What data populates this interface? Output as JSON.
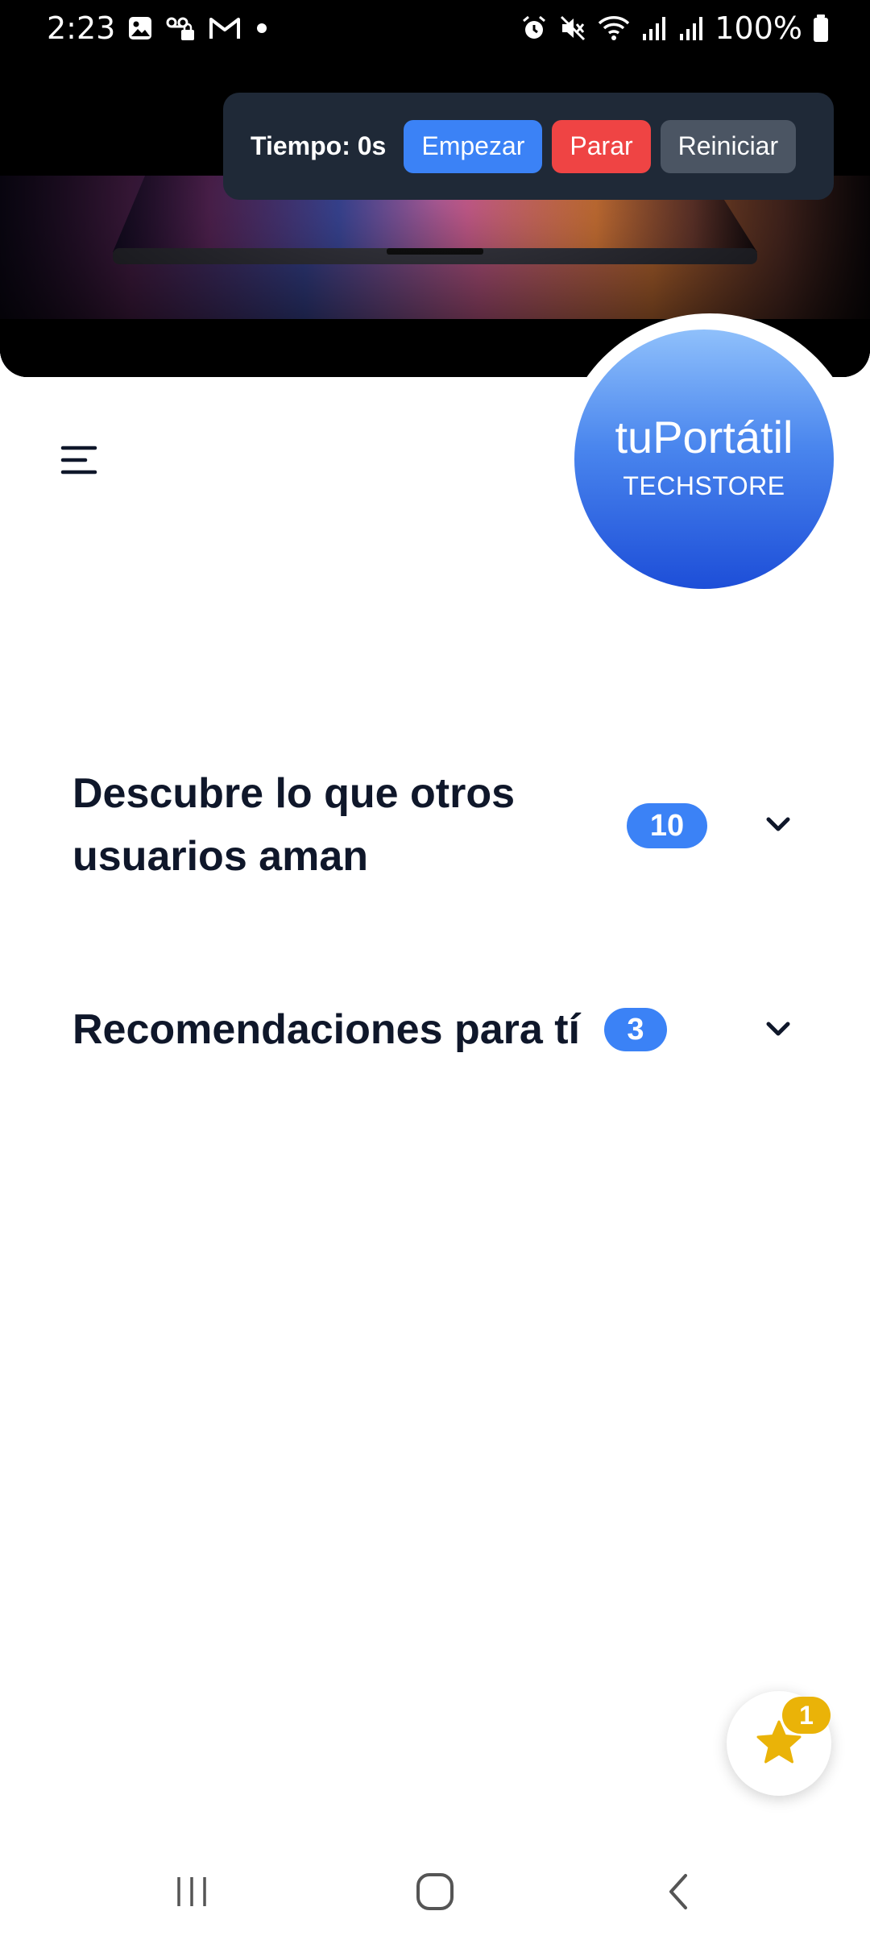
{
  "status_bar": {
    "time": "2:23",
    "battery_text": "100%",
    "left_icons": [
      "gallery-icon",
      "voicemail-lock-icon",
      "gmail-icon",
      "dot-icon"
    ],
    "right_icons": [
      "alarm-icon",
      "mute-icon",
      "wifi-icon",
      "signal-icon",
      "signal-icon",
      "battery-icon"
    ]
  },
  "timer": {
    "label": "Tiempo: 0s",
    "start_label": "Empezar",
    "stop_label": "Parar",
    "reset_label": "Reiniciar"
  },
  "logo": {
    "name": "tuPortátil",
    "tagline": "TECHSTORE"
  },
  "sections": [
    {
      "title_line1": "Descubre lo que otros",
      "title_line2": "usuarios aman",
      "count": "10"
    },
    {
      "title": "Recomendaciones para tí",
      "count": "3"
    }
  ],
  "favorites": {
    "count": "1",
    "icon": "star-icon"
  },
  "colors": {
    "accent_blue": "#3b82f6",
    "stop_red": "#ef4444",
    "reset_gray": "#4b5563",
    "timer_bg": "#1f2937",
    "star_yellow": "#eab308"
  }
}
